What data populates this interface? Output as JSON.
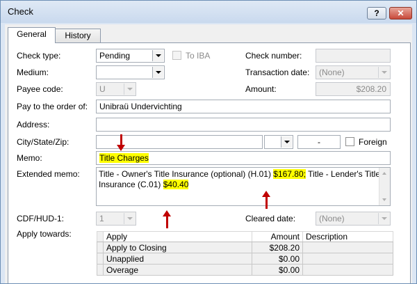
{
  "window": {
    "title": "Check",
    "help_label": "?",
    "close_label": "✕"
  },
  "tabs": [
    {
      "label": "General"
    },
    {
      "label": "History"
    }
  ],
  "form": {
    "check_type": {
      "label": "Check type:",
      "value": "Pending"
    },
    "to_iba": {
      "label": "To IBA",
      "checked": false
    },
    "check_number": {
      "label": "Check number:",
      "value": ""
    },
    "medium": {
      "label": "Medium:",
      "value": ""
    },
    "transaction_date": {
      "label": "Transaction date:",
      "value": "(None)"
    },
    "payee_code": {
      "label": "Payee code:",
      "value": "U"
    },
    "amount": {
      "label": "Amount:",
      "value": "$208.20"
    },
    "pay_to": {
      "label": "Pay to the order of:",
      "value": "Unibraü Undervichting"
    },
    "address": {
      "label": "Address:",
      "value": ""
    },
    "city_state_zip": {
      "label": "City/State/Zip:",
      "city": "",
      "state": "",
      "zip": "-"
    },
    "foreign": {
      "label": "Foreign",
      "checked": false
    },
    "memo": {
      "label": "Memo:",
      "value": "Title Charges"
    },
    "extended_memo": {
      "label": "Extended memo:",
      "part1": "Title - Owner's Title Insurance (optional) (H.01) ",
      "hl1": "$167.80;",
      "part2": " Title - Lender's Title Insurance (C.01) ",
      "hl2": "$40.40"
    },
    "cdf_hud": {
      "label": "CDF/HUD-1:",
      "value": "1"
    },
    "cleared_date": {
      "label": "Cleared date:",
      "value": "(None)"
    },
    "apply_towards": {
      "label": "Apply towards:"
    }
  },
  "apply_table": {
    "headers": {
      "apply": "Apply",
      "amount": "Amount",
      "description": "Description"
    },
    "rows": [
      {
        "apply": "Apply to Closing",
        "amount": "$208.20",
        "description": ""
      },
      {
        "apply": "Unapplied",
        "amount": "$0.00",
        "description": ""
      },
      {
        "apply": "Overage",
        "amount": "$0.00",
        "description": ""
      }
    ]
  },
  "colors": {
    "highlight": "#ffff00",
    "annotation_arrow": "#c00000"
  }
}
